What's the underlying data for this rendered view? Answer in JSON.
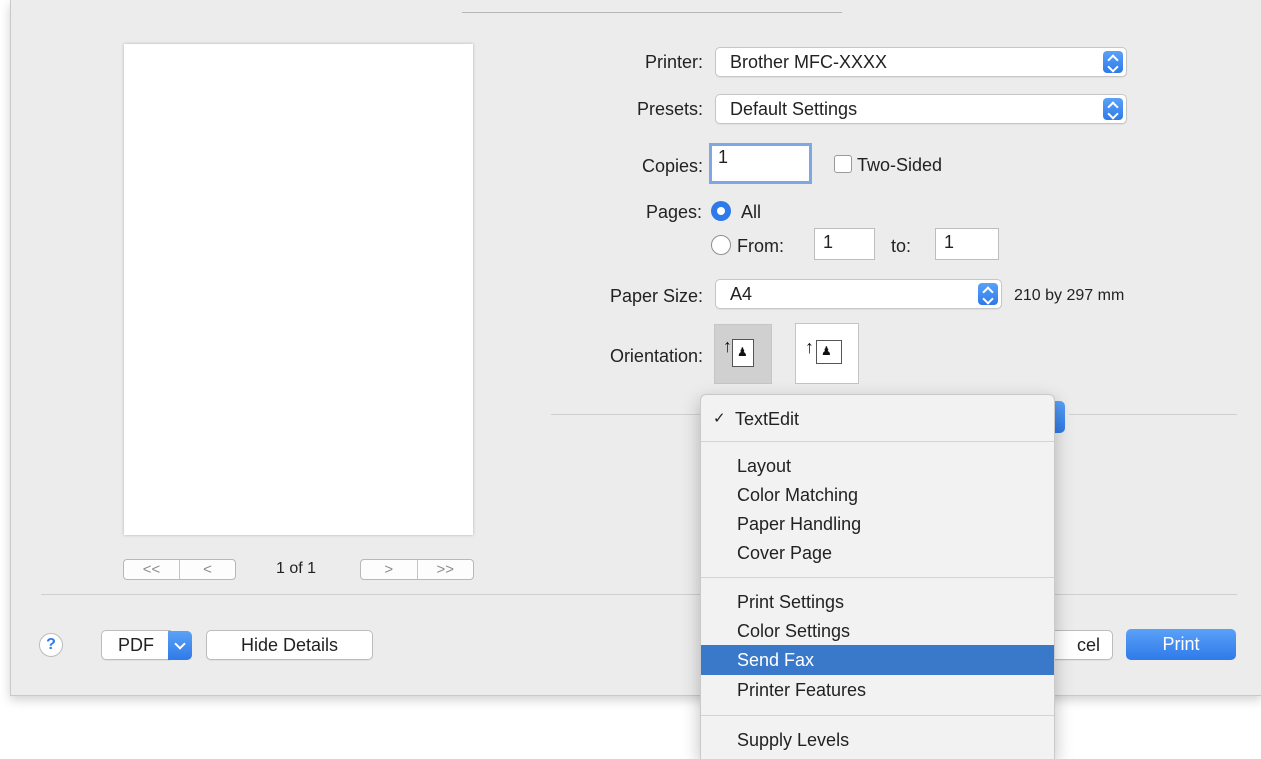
{
  "printer": {
    "label": "Printer:",
    "value": "Brother MFC-XXXX"
  },
  "presets": {
    "label": "Presets:",
    "value": "Default Settings"
  },
  "copies": {
    "label": "Copies:",
    "value": "1",
    "two_sided_label": "Two-Sided",
    "two_sided_checked": false
  },
  "pages": {
    "label": "Pages:",
    "all_label": "All",
    "from_label": "From:",
    "from_value": "1",
    "to_label": "to:",
    "to_value": "1",
    "selected": "All"
  },
  "paper_size": {
    "label": "Paper Size:",
    "value": "A4",
    "dimensions": "210 by 297 mm"
  },
  "orientation": {
    "label": "Orientation:",
    "options": [
      "portrait-icon",
      "landscape-icon"
    ],
    "selected": "portrait-icon"
  },
  "preview": {
    "page_count": "1 of 1",
    "nav_first": "<<",
    "nav_prev": "<",
    "nav_next": ">",
    "nav_last": ">>"
  },
  "footer": {
    "help": "?",
    "pdf_label": "PDF",
    "hide_details_label": "Hide Details",
    "cancel_label_visible": "cel",
    "print_label": "Print"
  },
  "menu": {
    "checked_item": "TextEdit",
    "groups": [
      [
        "TextEdit"
      ],
      [
        "Layout",
        "Color Matching",
        "Paper Handling",
        "Cover Page"
      ],
      [
        "Print Settings",
        "Color Settings",
        "Send Fax",
        "Printer Features"
      ],
      [
        "Supply Levels"
      ]
    ],
    "highlighted_item": "Send Fax",
    "checkmark": "✓"
  },
  "colors": {
    "accent": "#2f7ae9",
    "highlight": "#3a79c9",
    "sheet_bg": "#ececec"
  }
}
